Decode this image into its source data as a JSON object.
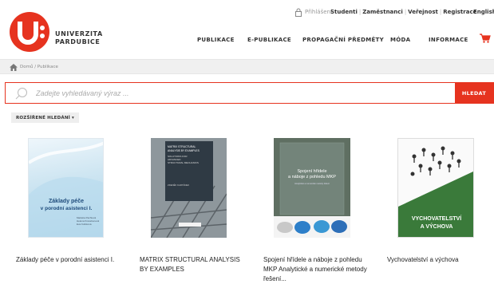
{
  "topbar": {
    "login": "Přihlášení",
    "links": [
      "Studenti",
      "Zaměstnanci",
      "Veřejnost",
      "Registrace"
    ],
    "language": "English"
  },
  "logo": {
    "line1": "UNIVERZITA",
    "line2": "PARDUBICE"
  },
  "nav": {
    "items": [
      "PUBLIKACE",
      "E-PUBLIKACE",
      "PROPAGAČNÍ PŘEDMĚTY",
      "MÓDA",
      "INFORMACE"
    ]
  },
  "breadcrumb": {
    "text": "Domů / Publikace"
  },
  "search": {
    "placeholder": "Zadejte vyhledávaný výraz ...",
    "button": "HLEDAT"
  },
  "advanced_search": "ROZŠÍŘENÉ HLEDÁNÍ",
  "books": [
    {
      "title": "Základy péče v porodní asistenci I.",
      "cover_title": "Základy péče v porodní asistenci I.",
      "cover_authors": "Markéta Pachtová, Helena Kranebenová, Eva Kubíková"
    },
    {
      "title": "MATRIX STRUCTURAL ANALYSIS BY EXAMPLES",
      "cover_title": "MATRIX STRUCTURAL ANALYSIS BY EXAMPLES",
      "cover_subtitle_1": "SOLUTIONS FOR",
      "cover_subtitle_2": "ADVANCED",
      "cover_subtitle_3": "STRUCTURAL MECHANICS",
      "cover_author": "ZDENĚK KARTÁNEK"
    },
    {
      "title": "Spojení hřídele a náboje z pohledu MKP Analytické a numerické metody řešení...",
      "cover_title": "Spojení hřídele a náboje z pohledu MKP",
      "cover_subtitle": "Analytické a numerické metody řešení"
    },
    {
      "title": "Vychovatelství a výchova",
      "cover_title_1": "VYCHOVATELSTVÍ",
      "cover_title_2": "A VÝCHOVA"
    }
  ]
}
